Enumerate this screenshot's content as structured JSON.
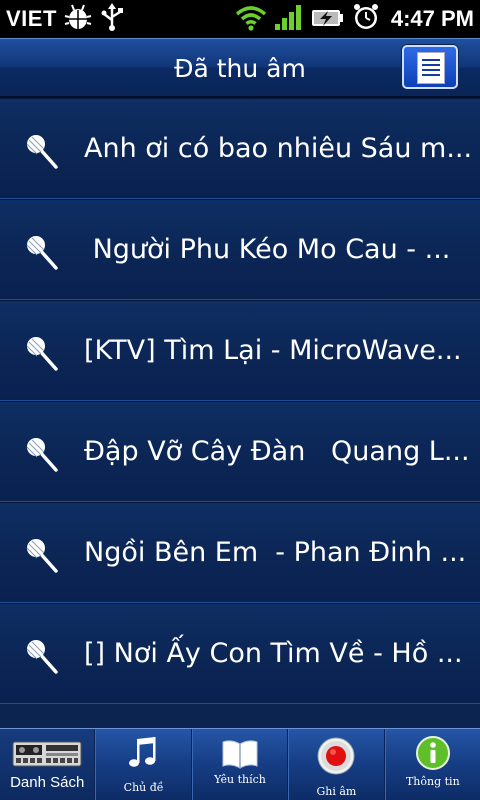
{
  "status_bar": {
    "carrier": "VIET",
    "time": "4:47 PM",
    "icons": [
      "android-debug-icon",
      "usb-icon",
      "wifi-icon",
      "signal-icon",
      "battery-charging-icon",
      "alarm-icon"
    ]
  },
  "header": {
    "title": "Đã thu âm",
    "menu_icon": "list-document-icon"
  },
  "recordings": [
    {
      "title": "Anh ơi có bao nhiêu Sáu m..."
    },
    {
      "title": " Người Phu Kéo Mo Cau - ..."
    },
    {
      "title": "[KTV] Tìm Lại - MicroWave..."
    },
    {
      "title": "Đập Vỡ Cây Đàn   Quang L..."
    },
    {
      "title": "Ngồi Bên Em  - Phan Đinh ..."
    },
    {
      "title": "[] Nơi Ấy Con Tìm Về - Hồ ..."
    }
  ],
  "tabs": [
    {
      "label": "Danh Sách",
      "icon": "cassette-deck-icon",
      "active": true
    },
    {
      "label": "Chủ đề",
      "icon": "music-note-icon",
      "active": false
    },
    {
      "label": "Yêu thích",
      "icon": "open-book-icon",
      "active": false
    },
    {
      "label": "Ghi âm",
      "icon": "record-icon",
      "active": false
    },
    {
      "label": "Thông tin",
      "icon": "info-icon",
      "active": false
    }
  ],
  "colors": {
    "background": "#0c2450",
    "header": "#11367a",
    "tabbar": "#163d84",
    "record_red": "#e01010",
    "info_green": "#5fbf2a"
  }
}
